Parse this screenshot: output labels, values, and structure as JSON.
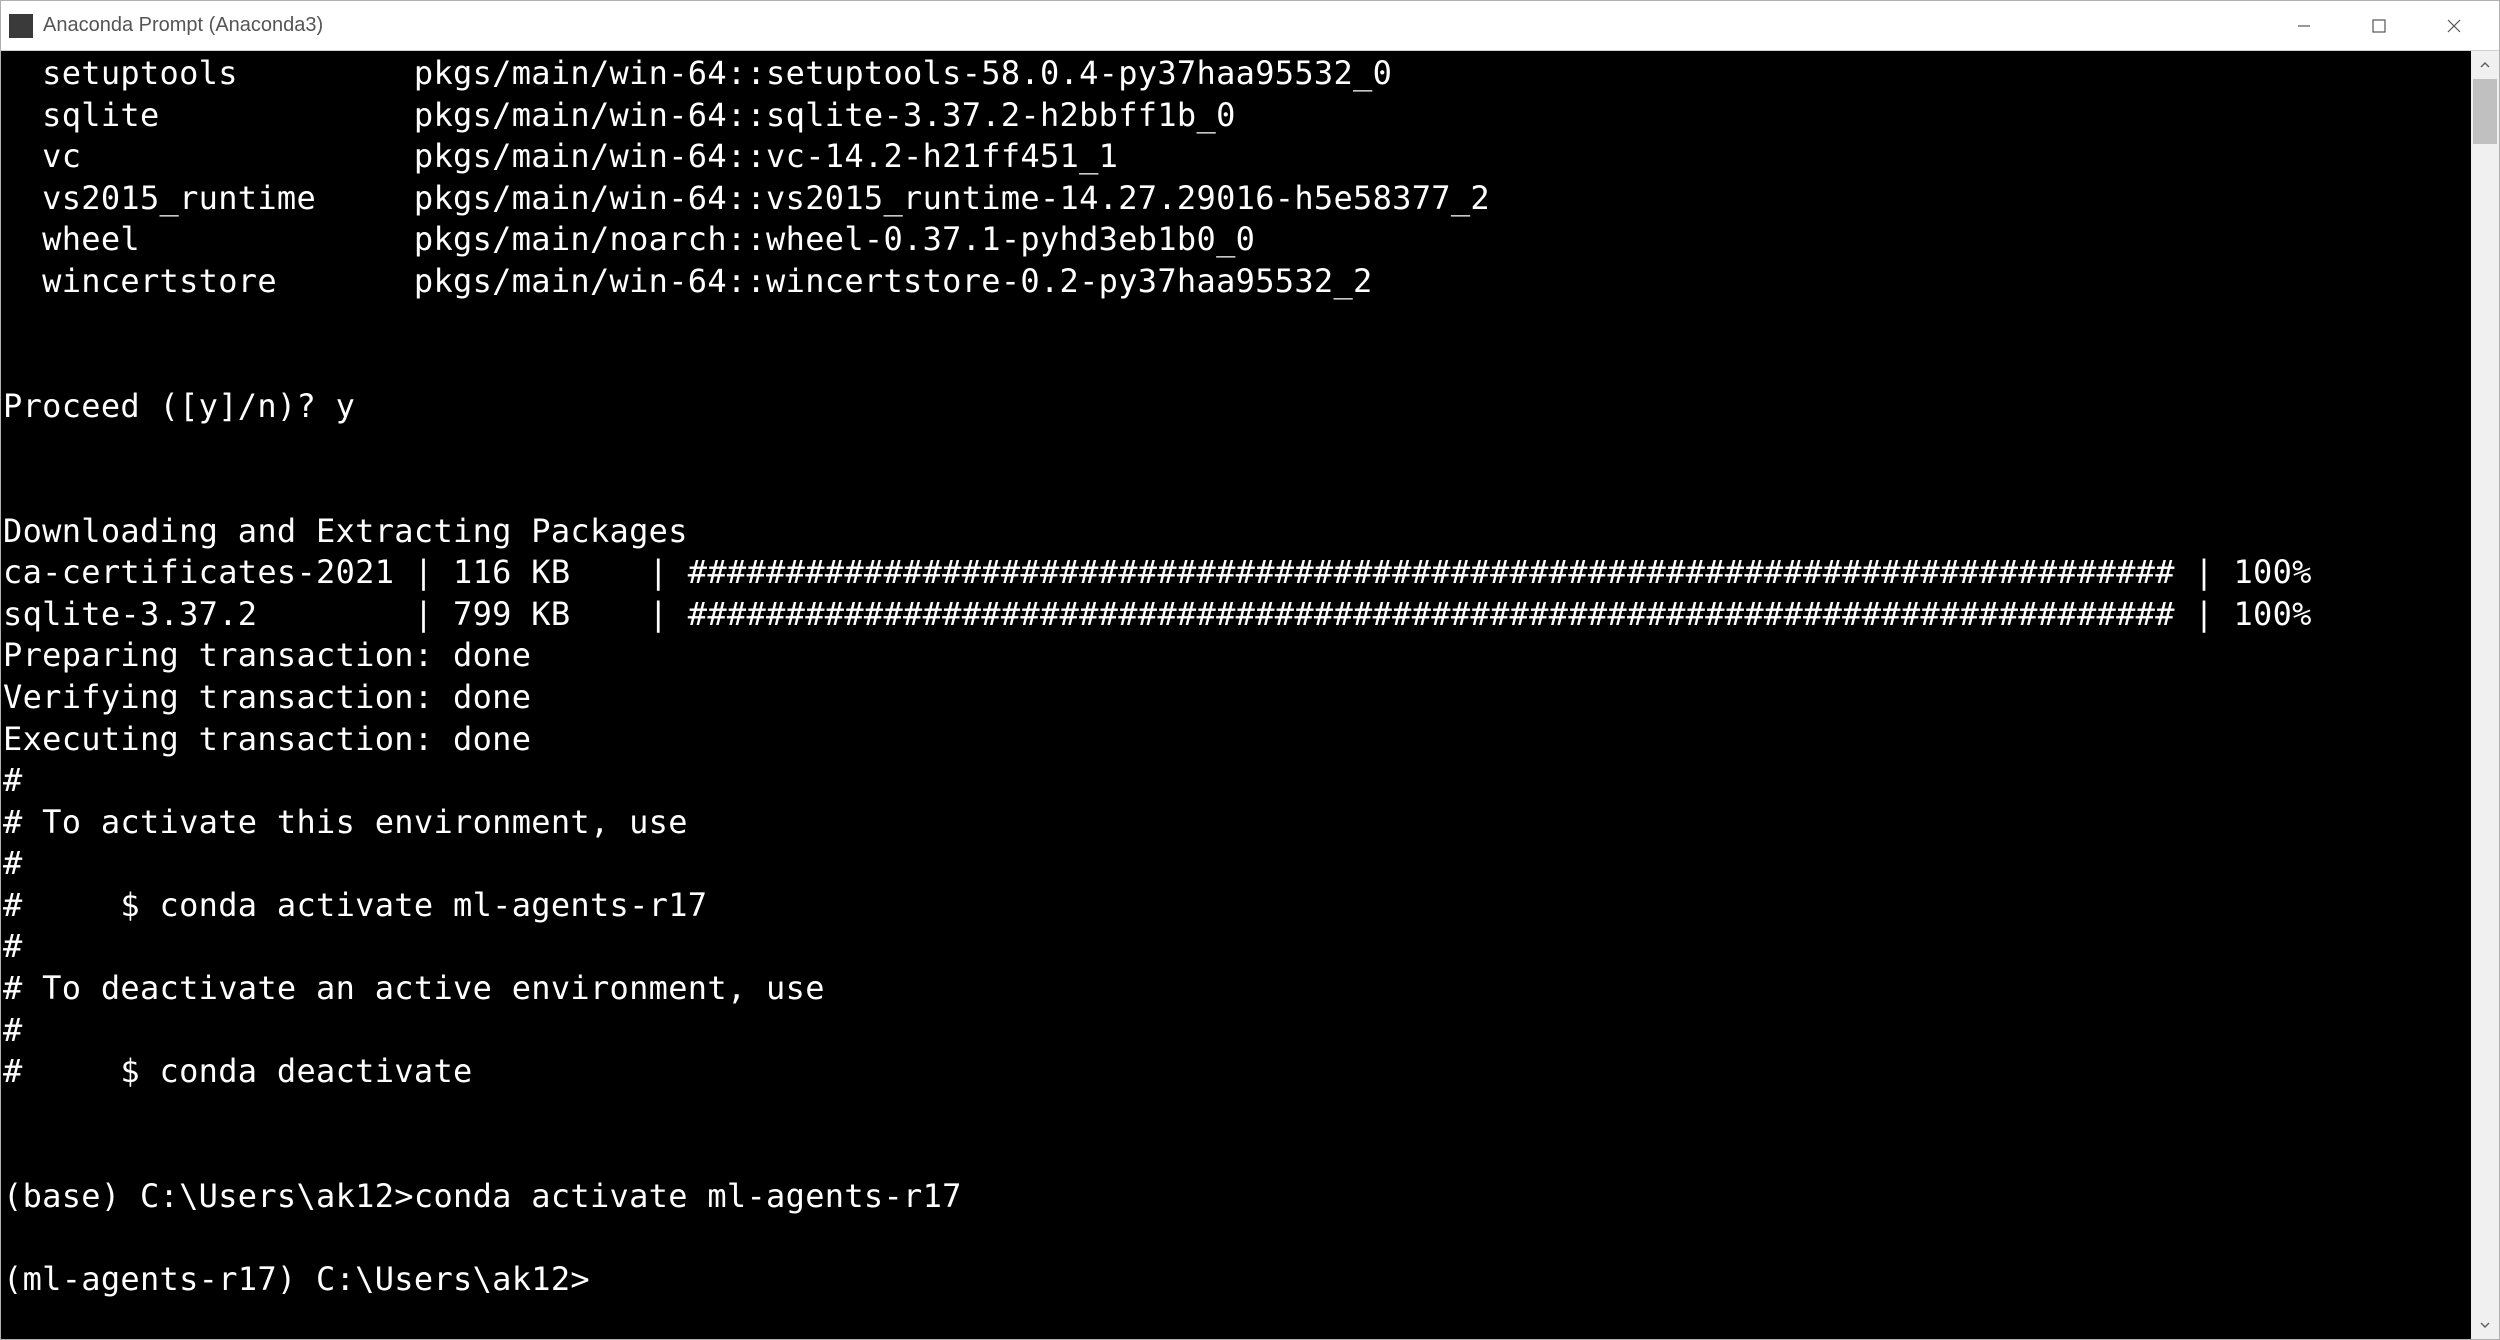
{
  "window": {
    "title": "Anaconda Prompt (Anaconda3)"
  },
  "packages": [
    {
      "name": "setuptools",
      "spec": "pkgs/main/win-64::setuptools-58.0.4-py37haa95532_0"
    },
    {
      "name": "sqlite",
      "spec": "pkgs/main/win-64::sqlite-3.37.2-h2bbff1b_0"
    },
    {
      "name": "vc",
      "spec": "pkgs/main/win-64::vc-14.2-h21ff451_1"
    },
    {
      "name": "vs2015_runtime",
      "spec": "pkgs/main/win-64::vs2015_runtime-14.27.29016-h5e58377_2"
    },
    {
      "name": "wheel",
      "spec": "pkgs/main/noarch::wheel-0.37.1-pyhd3eb1b0_0"
    },
    {
      "name": "wincertstore",
      "spec": "pkgs/main/win-64::wincertstore-0.2-py37haa95532_2"
    }
  ],
  "prompt": {
    "proceed_question": "Proceed ([y]/n)? ",
    "proceed_answer": "y"
  },
  "download_header": "Downloading and Extracting Packages",
  "downloads": [
    {
      "name": "ca-certificates-2021",
      "size": "116 KB",
      "percent": "100%"
    },
    {
      "name": "sqlite-3.37.2",
      "size": "799 KB",
      "percent": "100%"
    }
  ],
  "transactions": [
    "Preparing transaction: done",
    "Verifying transaction: done",
    "Executing transaction: done"
  ],
  "help_lines": [
    "#",
    "# To activate this environment, use",
    "#",
    "#     $ conda activate ml-agents-r17",
    "#",
    "# To deactivate an active environment, use",
    "#",
    "#     $ conda deactivate"
  ],
  "cmd1": {
    "prefix": "(base) C:\\Users\\ak12>",
    "command": "conda activate ml-agents-r17"
  },
  "cmd2": {
    "prefix": "(ml-agents-r17) C:\\Users\\ak12>",
    "command": ""
  }
}
